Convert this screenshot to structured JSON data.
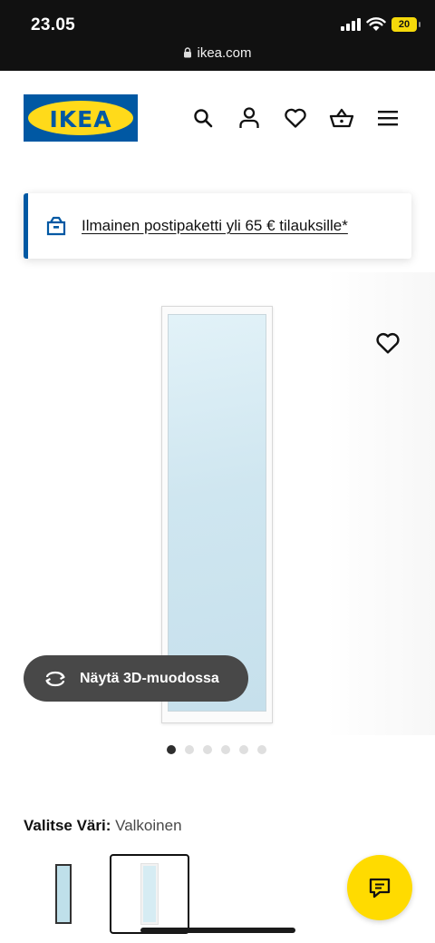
{
  "status_bar": {
    "time": "23.05",
    "battery_level": "20",
    "url": "ikea.com"
  },
  "header": {
    "logo_text": "IKEA",
    "icons": [
      "search-icon",
      "account-icon",
      "favorites-icon",
      "basket-icon",
      "menu-icon"
    ]
  },
  "promo": {
    "text": "Ilmainen postipaketti yli 65 € tilauksille*",
    "icon": "delivery-box-icon",
    "accent_color": "#0058a3"
  },
  "gallery": {
    "view_3d_label": "Näytä 3D-muodossa",
    "dots_total": 6,
    "active_dot": 1
  },
  "variant": {
    "label": "Valitse Väri:",
    "value": "Valkoinen",
    "options": [
      "black",
      "white"
    ],
    "selected": "white"
  },
  "colors": {
    "ikea_blue": "#0058a3",
    "ikea_yellow": "#ffda1a",
    "chat_yellow": "#ffdb00",
    "pill_dark": "#484848"
  }
}
